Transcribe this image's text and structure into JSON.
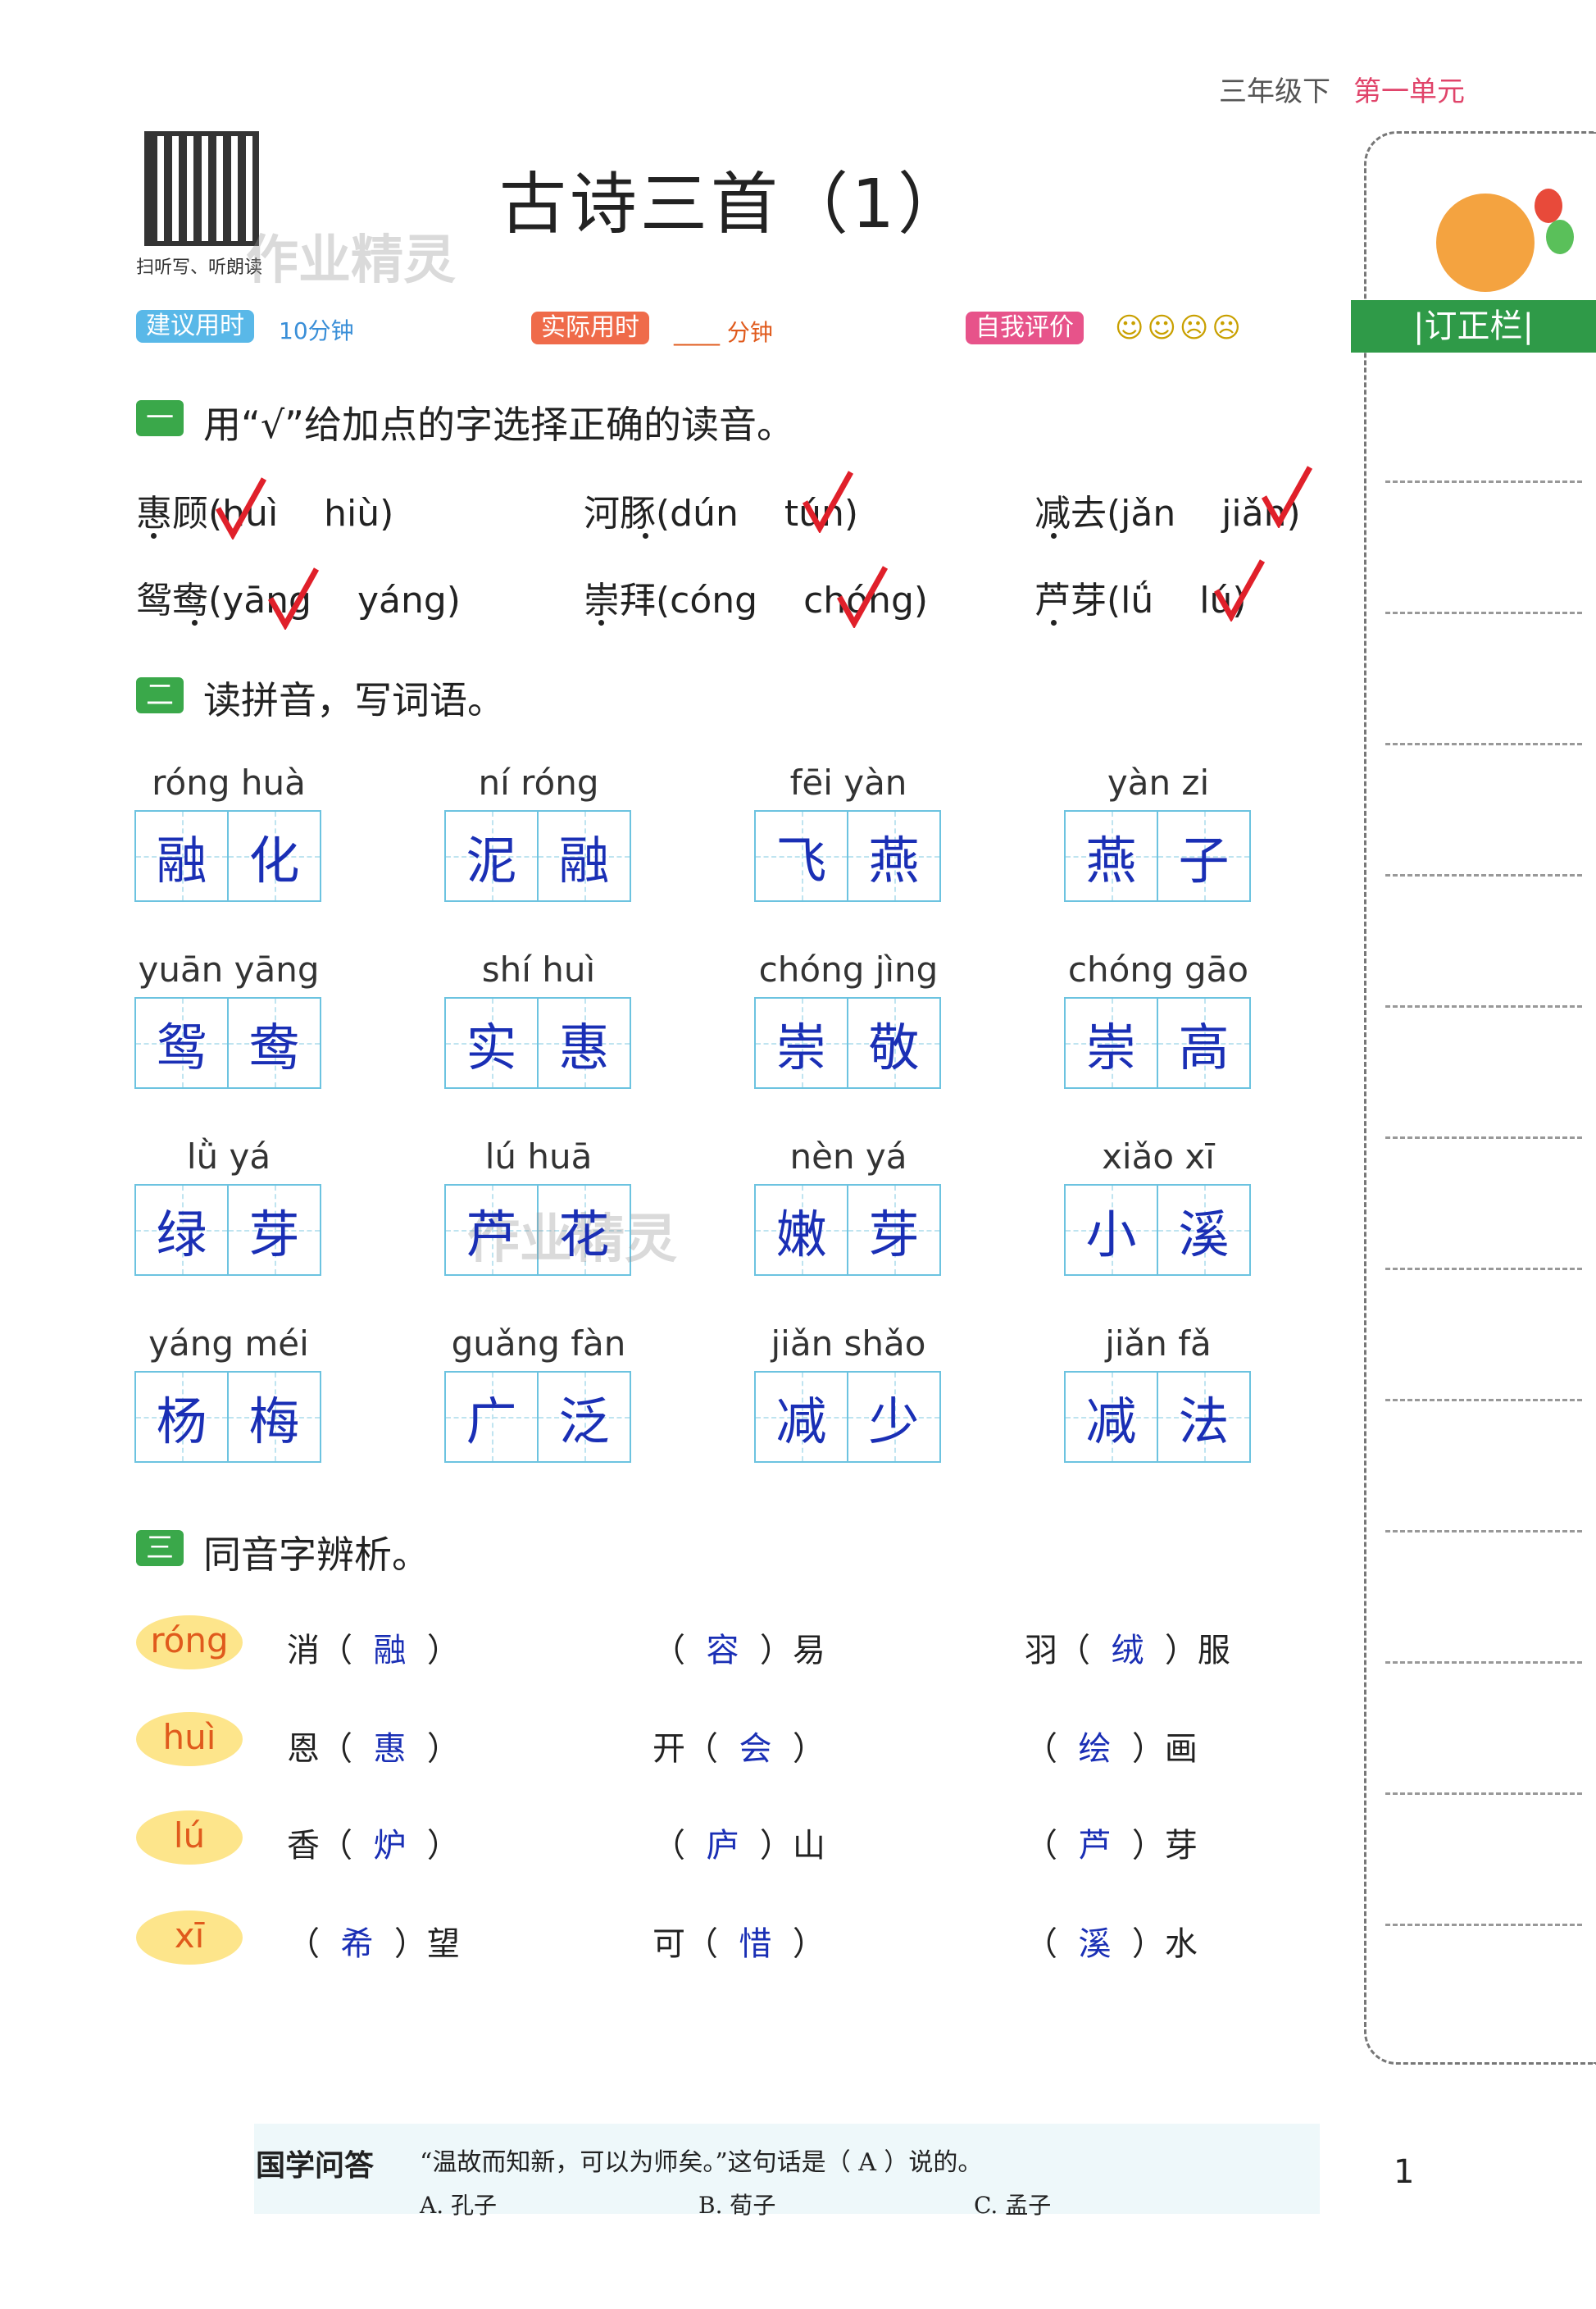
{
  "header": {
    "grade": "三年级下",
    "unit": "第一单元"
  },
  "qr_caption": "扫听写、听朗读",
  "watermark": "作业精灵",
  "title": "古诗三首（1）",
  "meta": {
    "suggest_label": "建议用时",
    "suggest_value": "10分钟",
    "actual_label": "实际用时",
    "actual_value": "____ 分钟",
    "self_label": "自我评价",
    "faces": "☺☺☹☹"
  },
  "section1": {
    "num": "一",
    "title": "用“√”给加点的字选择正确的读音。",
    "items": [
      {
        "word": "惠顾",
        "opt1": "huì",
        "opt2": "hiù"
      },
      {
        "word": "河豚",
        "opt1": "dún",
        "opt2": "tún"
      },
      {
        "word": "减去",
        "opt1": "jǎn",
        "opt2": "jiǎn"
      },
      {
        "word": "鸳鸯",
        "opt1": "yāng",
        "opt2": "yáng"
      },
      {
        "word": "崇拜",
        "opt1": "cóng",
        "opt2": "chóng"
      },
      {
        "word": "芦芽",
        "opt1": "lǘ",
        "opt2": "lú"
      }
    ]
  },
  "section2": {
    "num": "二",
    "title": "读拼音，写词语。",
    "words": [
      {
        "py": "róng huà",
        "c1": "融",
        "c2": "化"
      },
      {
        "py": "ní  róng",
        "c1": "泥",
        "c2": "融"
      },
      {
        "py": "fēi  yàn",
        "c1": "飞",
        "c2": "燕"
      },
      {
        "py": "yàn  zi",
        "c1": "燕",
        "c2": "子"
      },
      {
        "py": "yuān yāng",
        "c1": "鸳",
        "c2": "鸯"
      },
      {
        "py": "shí  huì",
        "c1": "实",
        "c2": "惠"
      },
      {
        "py": "chóng jìng",
        "c1": "崇",
        "c2": "敬"
      },
      {
        "py": "chóng gāo",
        "c1": "崇",
        "c2": "高"
      },
      {
        "py": "lǜ  yá",
        "c1": "绿",
        "c2": "芽"
      },
      {
        "py": "lú  huā",
        "c1": "芦",
        "c2": "花"
      },
      {
        "py": "nèn  yá",
        "c1": "嫩",
        "c2": "芽"
      },
      {
        "py": "xiǎo  xī",
        "c1": "小",
        "c2": "溪"
      },
      {
        "py": "yáng méi",
        "c1": "杨",
        "c2": "梅"
      },
      {
        "py": "guǎng fàn",
        "c1": "广",
        "c2": "泛"
      },
      {
        "py": "jiǎn shǎo",
        "c1": "减",
        "c2": "少"
      },
      {
        "py": "jiǎn  fǎ",
        "c1": "减",
        "c2": "法"
      }
    ]
  },
  "section3": {
    "num": "三",
    "title": "同音字辨析。",
    "rows": [
      {
        "tag": "róng",
        "cells": [
          {
            "pre": "消（",
            "ans": "融",
            "post": "）"
          },
          {
            "pre": "（",
            "ans": "容",
            "post": "）易"
          },
          {
            "pre": "羽（",
            "ans": "绒",
            "post": "）服"
          }
        ]
      },
      {
        "tag": "huì",
        "cells": [
          {
            "pre": "恩（",
            "ans": "惠",
            "post": "）"
          },
          {
            "pre": "开（",
            "ans": "会",
            "post": "）"
          },
          {
            "pre": "（",
            "ans": "绘",
            "post": "）画"
          }
        ]
      },
      {
        "tag": "lú",
        "cells": [
          {
            "pre": "香（",
            "ans": "炉",
            "post": "）"
          },
          {
            "pre": "（",
            "ans": "庐",
            "post": "）山"
          },
          {
            "pre": "（",
            "ans": "芦",
            "post": "）芽"
          }
        ]
      },
      {
        "tag": "xī",
        "cells": [
          {
            "pre": "（",
            "ans": "希",
            "post": "）望"
          },
          {
            "pre": "可（",
            "ans": "惜",
            "post": "）"
          },
          {
            "pre": "（",
            "ans": "溪",
            "post": "）水"
          }
        ]
      }
    ]
  },
  "sidebar": {
    "title": "|订正栏|"
  },
  "footer": {
    "label": "国学问答",
    "question": "“温故而知新，可以为师矣。”这句话是（ A ）说的。",
    "opt_a": "A. 孔子",
    "opt_b": "B. 荀子",
    "opt_c": "C. 孟子"
  },
  "page_number": "1"
}
